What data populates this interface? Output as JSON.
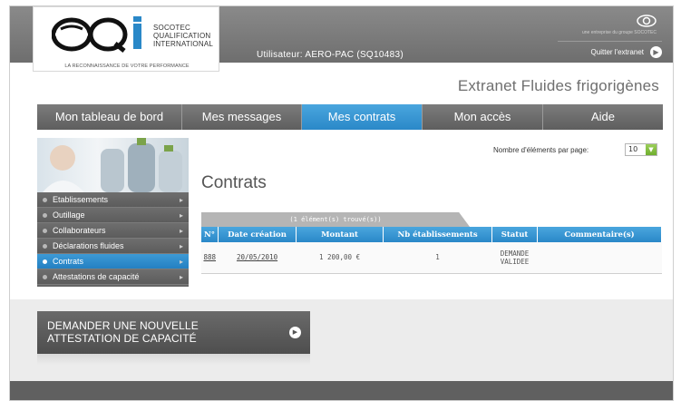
{
  "header": {
    "logo_line1": "SOCOTEC",
    "logo_line2": "QUALIFICATION",
    "logo_line3": "INTERNATIONAL",
    "logo_tagline": "LA RECONNAISSANCE DE VOTRE PERFORMANCE",
    "user": "Utilisateur: AERO-PAC (SQ10483)",
    "group_brand": "une entreprise du groupe SOCOTEC",
    "quit_label": "Quitter l'extranet",
    "site_title": "Extranet Fluides frigorigènes"
  },
  "nav": {
    "items": [
      {
        "label": "Mon tableau de bord"
      },
      {
        "label": "Mes messages"
      },
      {
        "label": "Mes contrats"
      },
      {
        "label": "Mon accès"
      },
      {
        "label": "Aide"
      }
    ],
    "active_index": 2
  },
  "sidebar": {
    "items": [
      {
        "label": "Etablissements"
      },
      {
        "label": "Outillage"
      },
      {
        "label": "Collaborateurs"
      },
      {
        "label": "Déclarations fluides"
      },
      {
        "label": "Contrats"
      },
      {
        "label": "Attestations de capacité"
      }
    ],
    "active_index": 4
  },
  "main": {
    "per_page_label": "Nombre d'éléments par page:",
    "per_page_value": "10",
    "title": "Contrats",
    "found_label": "(1 élément(s) trouvé(s))",
    "columns": [
      "N°",
      "Date création",
      "Montant",
      "Nb établissements",
      "Statut",
      "Commentaire(s)"
    ],
    "rows": [
      {
        "num": "888",
        "date": "20/05/2010",
        "montant": "1 200,00 €",
        "nb": "1",
        "statut_l1": "DEMANDE",
        "statut_l2": "VALIDEE",
        "commentaire": ""
      }
    ]
  },
  "cta": {
    "line1": "DEMANDER UNE NOUVELLE",
    "line2": "ATTESTATION DE CAPACITÉ"
  },
  "colors": {
    "accent_blue": "#2a88c8",
    "nav_gray": "#6f6f6f",
    "select_green": "#6fae2d"
  }
}
